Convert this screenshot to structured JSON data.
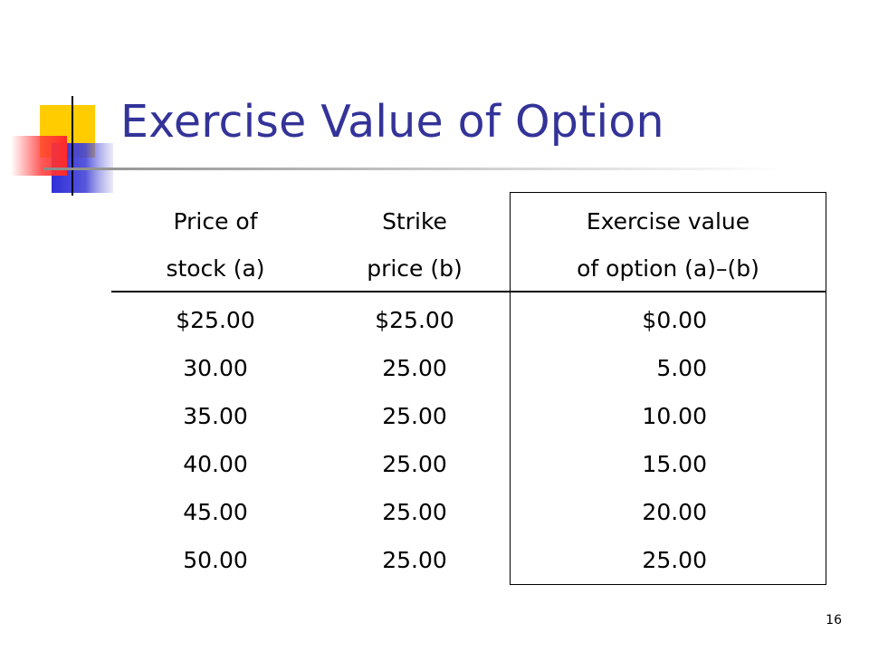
{
  "slide": {
    "title": "Exercise Value of Option",
    "page_number": "16",
    "accent_colors": {
      "title": "#333399",
      "yellow": "#FFCC00",
      "blue": "#3333CC",
      "red": "#FF3333"
    }
  },
  "table": {
    "headers": [
      [
        "Price of",
        "stock (a)"
      ],
      [
        "Strike",
        "price (b)"
      ],
      [
        "Exercise value",
        "of option (a)–(b)"
      ]
    ],
    "rows": [
      [
        "$25.00",
        "$25.00",
        "$0.00"
      ],
      [
        "30.00",
        "25.00",
        "5.00"
      ],
      [
        "35.00",
        "25.00",
        "10.00"
      ],
      [
        "40.00",
        "25.00",
        "15.00"
      ],
      [
        "45.00",
        "25.00",
        "20.00"
      ],
      [
        "50.00",
        "25.00",
        "25.00"
      ]
    ]
  }
}
